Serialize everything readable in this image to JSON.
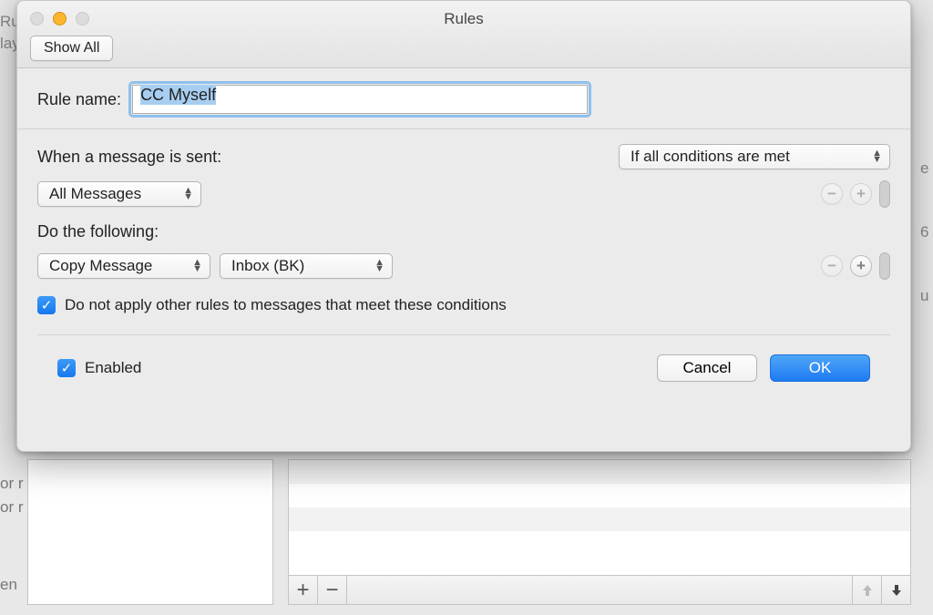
{
  "background": {
    "left_lines": [
      "Rur",
      "lay"
    ],
    "right_letters": [
      "e",
      "6",
      "u"
    ],
    "left_below": [
      "or r",
      "or r",
      "en"
    ]
  },
  "dialog": {
    "title": "Rules",
    "show_all_label": "Show All",
    "rule_name_label": "Rule name:",
    "rule_name_value": "CC Myself",
    "when_sent_label": "When a message is sent:",
    "condition_match_label": "If all conditions are met",
    "condition_item": "All Messages",
    "do_following_label": "Do the following:",
    "action_select": "Copy Message",
    "action_target": "Inbox (BK)",
    "do_not_apply_label": "Do not apply other rules to messages that meet these conditions",
    "do_not_apply_checked": true,
    "enabled_label": "Enabled",
    "enabled_checked": true,
    "cancel_label": "Cancel",
    "ok_label": "OK"
  }
}
